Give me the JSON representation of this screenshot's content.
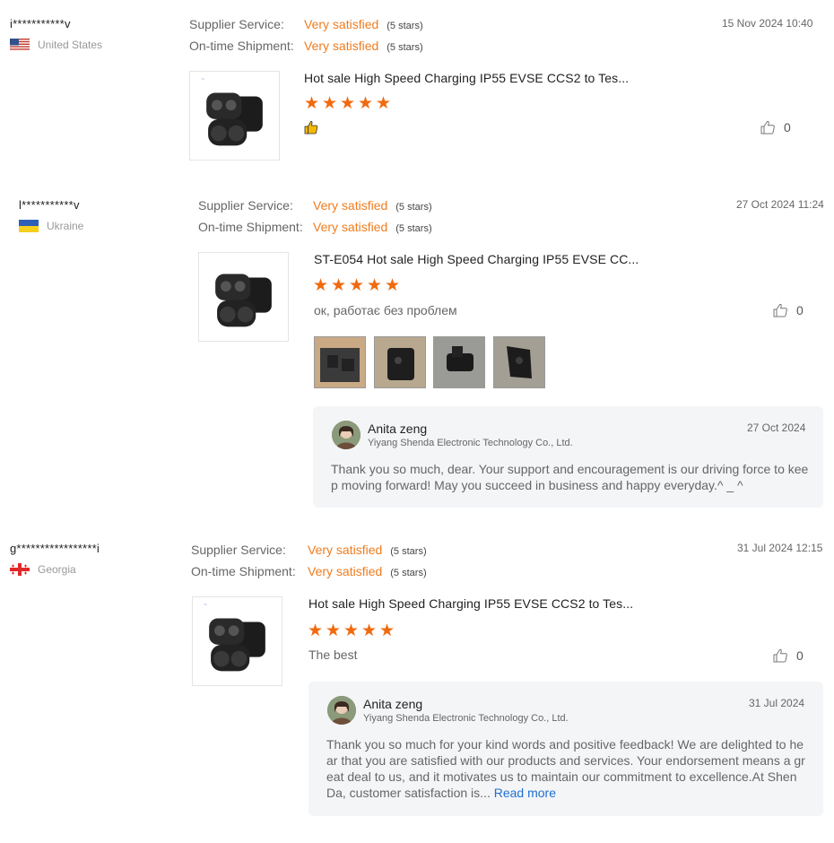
{
  "labels": {
    "supplier_service": "Supplier Service:",
    "ontime_shipment": "On-time Shipment:"
  },
  "colors": {
    "accent_orange": "#f07c1e",
    "star_orange": "#f06a0f",
    "link_blue": "#1f6fd1",
    "reply_bg": "#f4f5f7"
  },
  "reviews": [
    {
      "reviewer": "i***********v",
      "country": "United States",
      "flag_icon": "us-flag-icon",
      "supplier_service": {
        "value": "Very satisfied",
        "stars": "(5 stars)"
      },
      "ontime_shipment": {
        "value": "Very satisfied",
        "stars": "(5 stars)"
      },
      "date": "15 Nov 2024 10:40",
      "product_title": "Hot sale High Speed Charging IP55 EVSE CCS2 to Tes...",
      "rating": 5,
      "comment_icon": "thumbs-up-emoji-icon",
      "likes": "0"
    },
    {
      "reviewer": "l***********v",
      "country": "Ukraine",
      "flag_icon": "ukraine-flag-icon",
      "supplier_service": {
        "value": "Very satisfied",
        "stars": "(5 stars)"
      },
      "ontime_shipment": {
        "value": "Very satisfied",
        "stars": "(5 stars)"
      },
      "date": "27 Oct 2024 11:24",
      "product_title": "ST-E054 Hot sale High Speed Charging IP55 EVSE CC...",
      "rating": 5,
      "comment": "ок, работає без проблем",
      "likes": "0",
      "photos": 4,
      "reply": {
        "name": "Anita zeng",
        "company": "Yiyang Shenda Electronic Technology Co., Ltd.",
        "date": "27 Oct 2024",
        "lines": [
          "Thank you so much, dear. Your support and encouragement is our driving force to kee",
          "p moving forward! May you succeed in business and happy everyday.^ _ ^"
        ]
      }
    },
    {
      "reviewer": "g*****************i",
      "country": "Georgia",
      "flag_icon": "georgia-flag-icon",
      "supplier_service": {
        "value": "Very satisfied",
        "stars": "(5 stars)"
      },
      "ontime_shipment": {
        "value": "Very satisfied",
        "stars": "(5 stars)"
      },
      "date": "31 Jul 2024 12:15",
      "product_title": "Hot sale High Speed Charging IP55 EVSE CCS2 to Tes...",
      "rating": 5,
      "comment": "The best",
      "likes": "0",
      "reply": {
        "name": "Anita zeng",
        "company": "Yiyang Shenda Electronic Technology Co., Ltd.",
        "date": "31 Jul 2024",
        "lines": [
          "Thank you so much for your kind words and positive feedback! We are delighted to he",
          "ar that you are satisfied with our products and services. Your endorsement means a gr",
          "eat deal to us, and it motivates us to maintain our commitment to excellence.At Shen",
          "Da, customer satisfaction is..."
        ],
        "read_more": "Read more"
      }
    }
  ]
}
